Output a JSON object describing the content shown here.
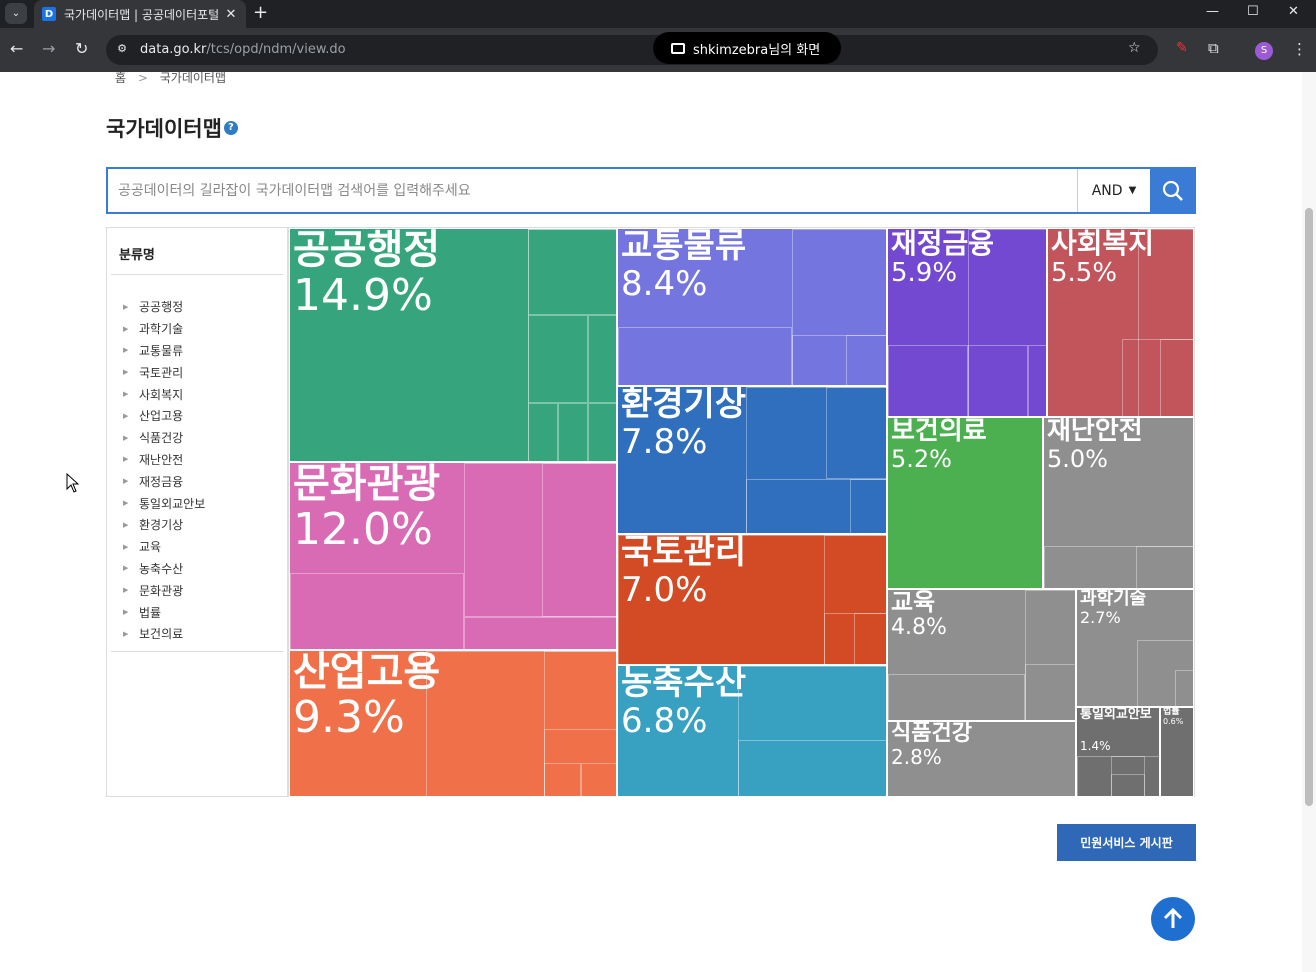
{
  "browser": {
    "tab_title": "국가데이터맵 | 공공데이터포털",
    "favicon_letter": "D",
    "url_host": "data.go.kr",
    "url_path": "/tcs/opd/ndm/view.do",
    "share_label": "shkimzebra님의 화면",
    "profile_initial": "S"
  },
  "breadcrumb": {
    "home": "홈",
    "current": "국가데이터맵"
  },
  "page_title": "국가데이터맵",
  "search": {
    "placeholder": "공공데이터의 길라잡이 국가데이터맵 검색어를 입력해주세요",
    "operator": "AND"
  },
  "sidebar": {
    "title": "분류명",
    "items": [
      "공공행정",
      "과학기술",
      "교통물류",
      "국토관리",
      "사회복지",
      "산업고용",
      "식품건강",
      "재난안전",
      "재정금융",
      "통일외교안보",
      "환경기상",
      "교육",
      "농축수산",
      "문화관광",
      "법률",
      "보건의료"
    ]
  },
  "treemap": [
    {
      "name": "공공행정",
      "pct": "14.9%",
      "color": "#36a57d"
    },
    {
      "name": "문화관광",
      "pct": "12.0%",
      "color": "#d96bb5"
    },
    {
      "name": "산업고용",
      "pct": "9.3%",
      "color": "#f0704a"
    },
    {
      "name": "교통물류",
      "pct": "8.4%",
      "color": "#7575e0"
    },
    {
      "name": "환경기상",
      "pct": "7.8%",
      "color": "#2f6fbd"
    },
    {
      "name": "국토관리",
      "pct": "7.0%",
      "color": "#d24b25"
    },
    {
      "name": "농축수산",
      "pct": "6.8%",
      "color": "#38a0c0"
    },
    {
      "name": "재정금융",
      "pct": "5.9%",
      "color": "#7349d2"
    },
    {
      "name": "사회복지",
      "pct": "5.5%",
      "color": "#c2555c"
    },
    {
      "name": "보건의료",
      "pct": "5.2%",
      "color": "#4caf50"
    },
    {
      "name": "재난안전",
      "pct": "5.0%",
      "color": "#8f8f8f"
    },
    {
      "name": "교육",
      "pct": "4.8%",
      "color": "#8f8f8f"
    },
    {
      "name": "식품건강",
      "pct": "2.8%",
      "color": "#8f8f8f"
    },
    {
      "name": "과학기술",
      "pct": "2.7%",
      "color": "#8f8f8f"
    },
    {
      "name": "통일외교안보",
      "pct": "1.4%",
      "color": "#6f6f6f"
    },
    {
      "name": "법률",
      "pct": "0.6%",
      "color": "#6f6f6f"
    }
  ],
  "buttons": {
    "civil_service": "민원서비스 게시판"
  }
}
